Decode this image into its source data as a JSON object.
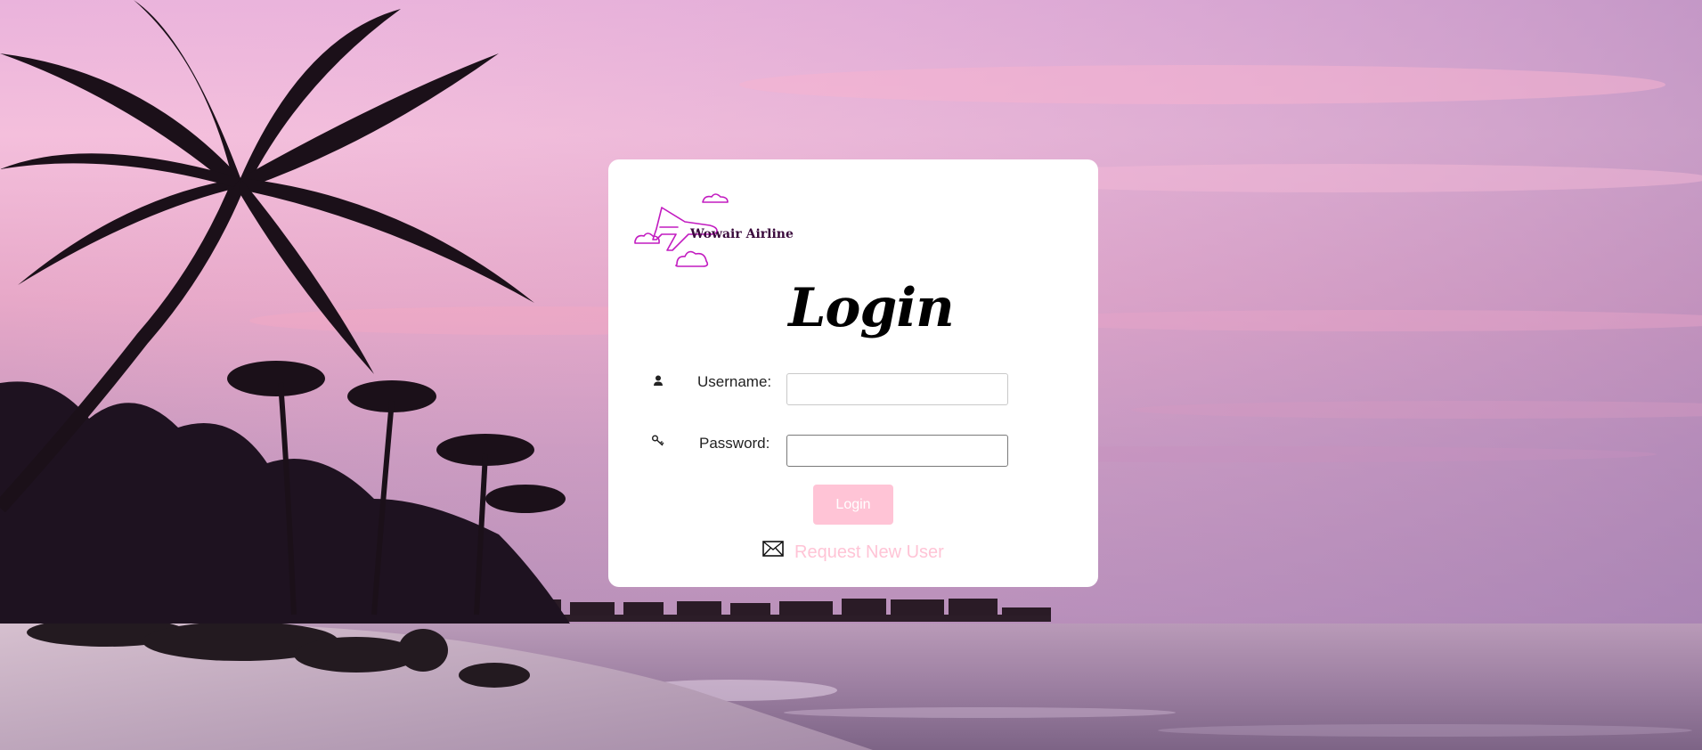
{
  "brand": {
    "name": "Wowair Airline",
    "accent_color": "#c21bc0"
  },
  "login_form": {
    "title": "Login",
    "username_label": "Username:",
    "username_value": "",
    "password_label": "Password:",
    "password_value": "",
    "submit_label": "Login",
    "submit_color": "#ffc4d6",
    "request_link_label": "Request New User"
  },
  "icons": {
    "username": "user-icon",
    "password": "key-icon",
    "request": "envelope-icon",
    "logo": "airplane-clouds-logo"
  },
  "background": {
    "description_colors": [
      "#f5bfdc",
      "#d99bc4",
      "#a987b7",
      "#1f0f1c"
    ]
  }
}
